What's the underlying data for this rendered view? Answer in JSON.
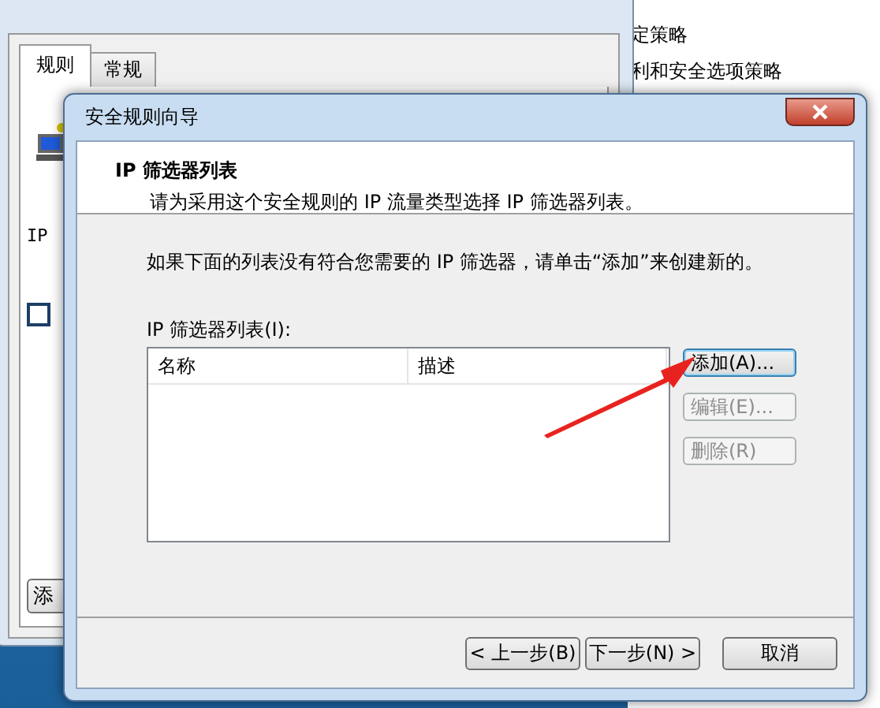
{
  "back_window": {
    "tabs": [
      {
        "label": "规则",
        "selected": true
      },
      {
        "label": "常规",
        "selected": false
      }
    ],
    "section_label": "IP",
    "rule_checkbox": {
      "checked": false
    },
    "add_button": "添"
  },
  "side_panel": {
    "items": [
      "定策略",
      "利和安全选项策略"
    ]
  },
  "dialog": {
    "title": "安全规则向导",
    "heading": "IP 筛选器列表",
    "subheading": "请为采用这个安全规则的 IP 流量类型选择 IP 筛选器列表。",
    "instruction": "如果下面的列表没有符合您需要的 IP 筛选器，请单击“添加”来创建新的。",
    "list_label": "IP 筛选器列表(I):",
    "columns": [
      "名称",
      "描述"
    ],
    "side_buttons": [
      {
        "label": "添加(A)...",
        "disabled": false,
        "focused": true
      },
      {
        "label": "编辑(E)...",
        "disabled": true,
        "focused": false
      },
      {
        "label": "删除(R)",
        "disabled": true,
        "focused": false
      }
    ],
    "footer_buttons": [
      "< 上一步(B)",
      "下一步(N) >",
      "取消"
    ]
  },
  "annotation": {
    "kind": "arrow"
  }
}
